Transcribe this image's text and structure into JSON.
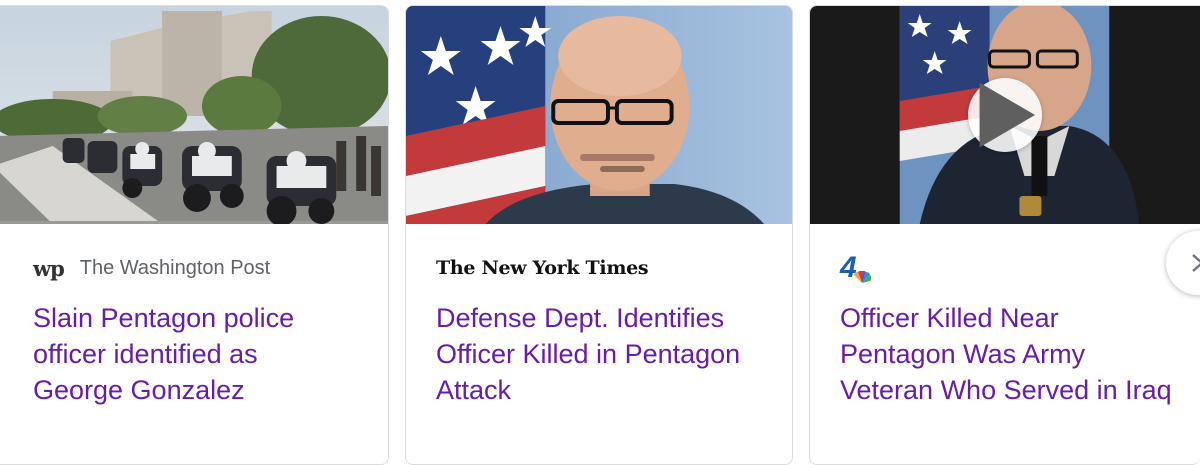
{
  "cards": [
    {
      "source": "The Washington Post",
      "source_logo_text": "wp",
      "headline": "Slain Pentagon police officer identified as George Gonzalez",
      "thumbnail_icon": "motorcycle-procession-image"
    },
    {
      "source_logo_text": "The New York Times",
      "headline": "Defense Dept. Identifies Officer Killed in Pentagon Attack",
      "thumbnail_icon": "officer-portrait-image"
    },
    {
      "source_logo_text": "4",
      "headline": "Officer Killed Near Pentagon Was Army Veteran Who Served in Iraq",
      "thumbnail_icon": "officer-portrait-video-image",
      "has_video": true
    }
  ],
  "controls": {
    "play_icon": "play-icon",
    "next_icon": "chevron-right-icon"
  },
  "colors": {
    "headline": "#681da8",
    "source_text": "#5f6368",
    "card_border": "#dadce0",
    "nbc_blue": "#1a5fb4"
  }
}
